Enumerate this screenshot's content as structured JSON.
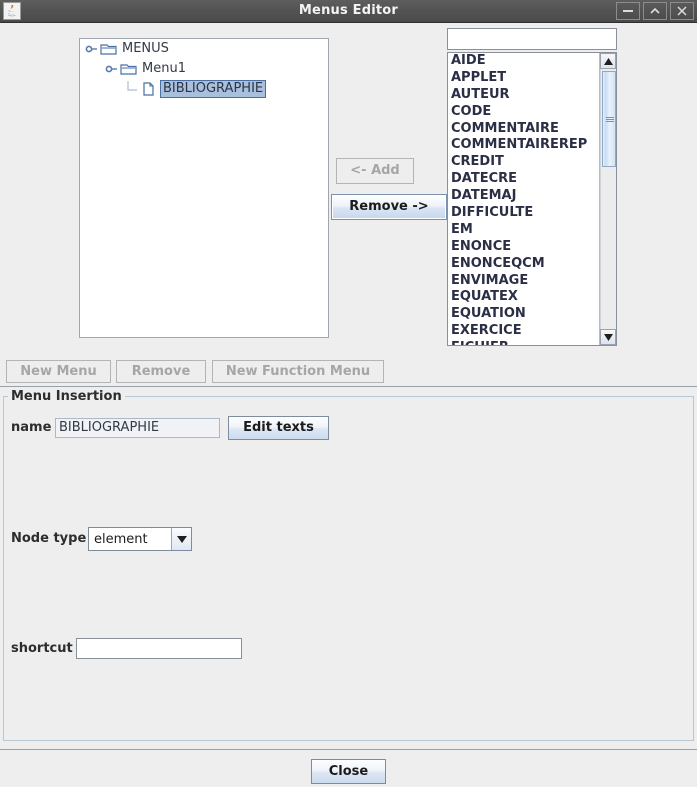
{
  "window": {
    "title": "Menus Editor",
    "app_icon": "java-icon",
    "buttons": {
      "minimize": "minimize-icon",
      "maximize": "maximize-icon",
      "close": "close-icon"
    }
  },
  "tree": {
    "nodes": [
      {
        "label": "MENUS",
        "level": 0,
        "icon": "folder-icon",
        "expanded": true,
        "selected": false
      },
      {
        "label": "Menu1",
        "level": 1,
        "icon": "folder-icon",
        "expanded": true,
        "selected": false
      },
      {
        "label": "BIBLIOGRAPHIE",
        "level": 2,
        "icon": "document-icon",
        "expanded": false,
        "selected": true
      }
    ]
  },
  "transfer_buttons": {
    "add_label": "<- Add",
    "add_enabled": false,
    "remove_label": "Remove ->",
    "remove_enabled": true
  },
  "filter": {
    "value": "",
    "placeholder": ""
  },
  "element_list": {
    "items": [
      "AIDE",
      "APPLET",
      "AUTEUR",
      "CODE",
      "COMMENTAIRE",
      "COMMENTAIREREP",
      "CREDIT",
      "DATECRE",
      "DATEMAJ",
      "DIFFICULTE",
      "EM",
      "ENONCE",
      "ENONCEQCM",
      "ENVIMAGE",
      "EQUATEX",
      "EQUATION",
      "EXERCICE",
      "FICHIER"
    ],
    "scrollbar": {
      "up_arrow": "scroll-up-icon",
      "down_arrow": "scroll-down-icon",
      "thumb_position": "top"
    }
  },
  "action_buttons": [
    {
      "label": "New Menu",
      "enabled": false
    },
    {
      "label": "Remove",
      "enabled": false
    },
    {
      "label": "New Function Menu",
      "enabled": false
    }
  ],
  "menu_insertion": {
    "title": "Menu Insertion",
    "name_label": "name",
    "name_value": "BIBLIOGRAPHIE",
    "edit_texts_label": "Edit texts",
    "node_type_label": "Node type",
    "node_type_value": "element",
    "node_type_options": [
      "element"
    ],
    "shortcut_label": "shortcut",
    "shortcut_value": "",
    "shortcut_placeholder": ""
  },
  "footer": {
    "close_label": "Close"
  },
  "colors": {
    "titlebar": "#535353",
    "panel_bg": "#eeeeee",
    "field_bg": "#ffffff",
    "selection": "#a8c0dd",
    "accent": "#4a6fa5",
    "disabled_text": "#a6a6a6"
  }
}
